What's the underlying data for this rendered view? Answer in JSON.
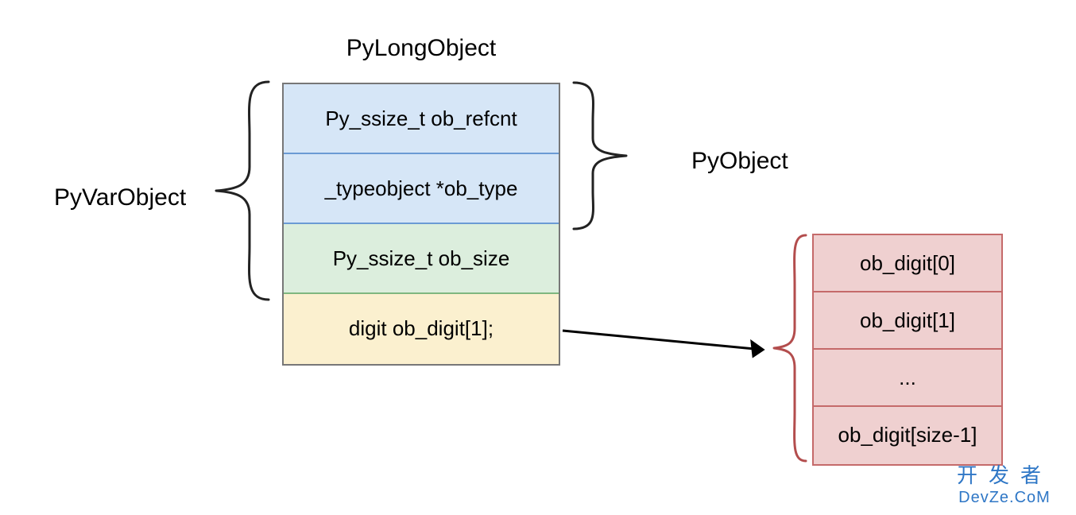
{
  "title": "PyLongObject",
  "left_label": "PyVarObject",
  "right_label": "PyObject",
  "struct": {
    "row0": "Py_ssize_t ob_refcnt",
    "row1": "_typeobject *ob_type",
    "row2": "Py_ssize_t ob_size",
    "row3": "digit ob_digit[1];"
  },
  "array": {
    "row0": "ob_digit[0]",
    "row1": "ob_digit[1]",
    "row2": "...",
    "row3": "ob_digit[size-1]"
  },
  "watermark": {
    "cn": "开发者",
    "en": "DevZe.CoM"
  }
}
